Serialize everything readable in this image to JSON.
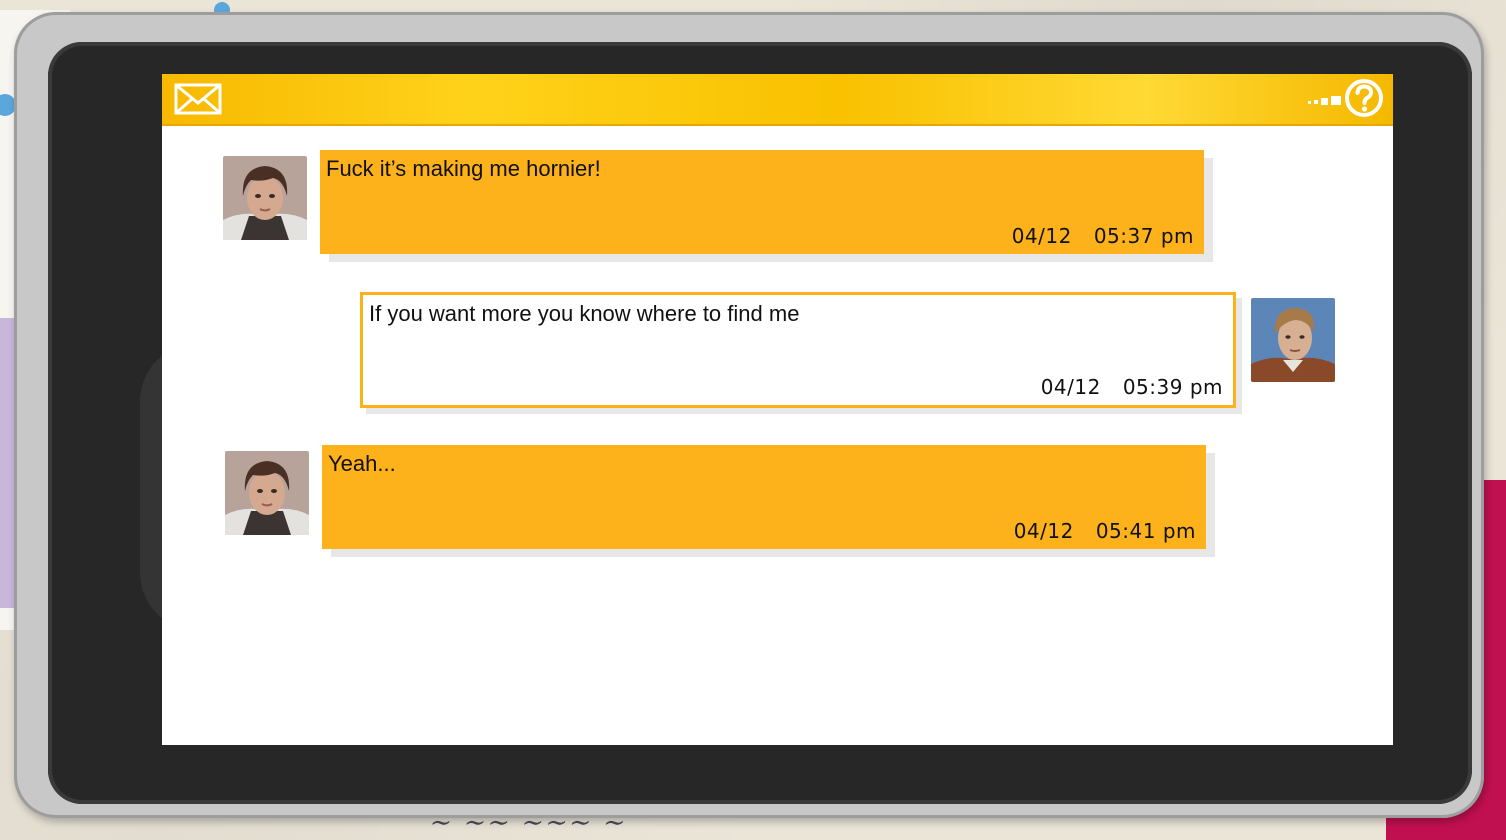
{
  "header": {
    "mail_icon": "envelope-icon",
    "signal_icon": "signal-icon",
    "help_icon": "question-circle-icon",
    "bar_color": "#f9c100"
  },
  "colors": {
    "accent": "#fdb21b",
    "screen_bg": "#ffffff",
    "phone_body": "#272727"
  },
  "messages": [
    {
      "direction": "incoming",
      "avatar": "girl-avatar",
      "text": "Fuck it’s making me hornier!",
      "date": "04/12",
      "time": "05:37 pm"
    },
    {
      "direction": "outgoing",
      "avatar": "boy-avatar",
      "text": "If you want more you know where to find me",
      "date": "04/12",
      "time": "05:39 pm"
    },
    {
      "direction": "incoming",
      "avatar": "girl-avatar",
      "text": "Yeah...",
      "date": "04/12",
      "time": "05:41 pm"
    }
  ]
}
